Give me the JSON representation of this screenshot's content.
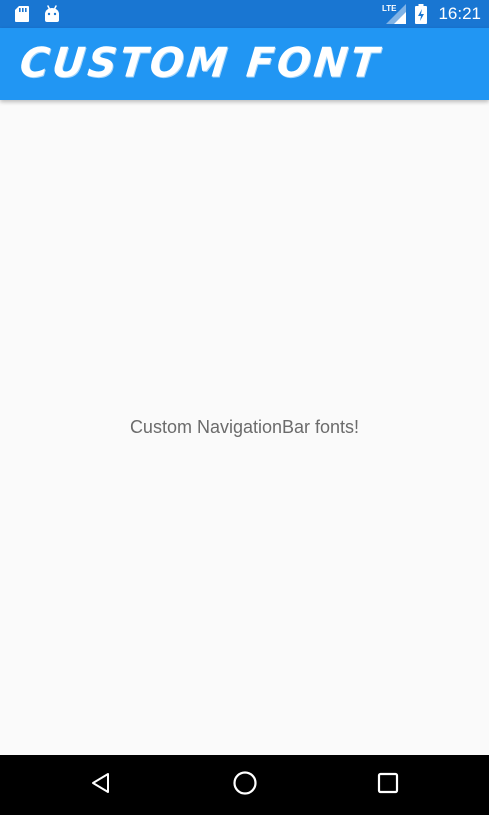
{
  "status_bar": {
    "time": "16:21",
    "network_label": "LTE",
    "icons": [
      "sd-card-icon",
      "android-icon",
      "lte-signal-icon",
      "battery-charging-icon"
    ]
  },
  "app_bar": {
    "title": "CUSTOM FONT"
  },
  "main": {
    "label": "Custom NavigationBar fonts!"
  },
  "nav_bar": {
    "buttons": [
      "back-icon",
      "home-icon",
      "recents-icon"
    ]
  },
  "colors": {
    "status_bar": "#1976d2",
    "app_bar": "#2196f3",
    "background": "#fafafa",
    "label_text": "#6b6b6b",
    "nav_bar": "#000000"
  }
}
